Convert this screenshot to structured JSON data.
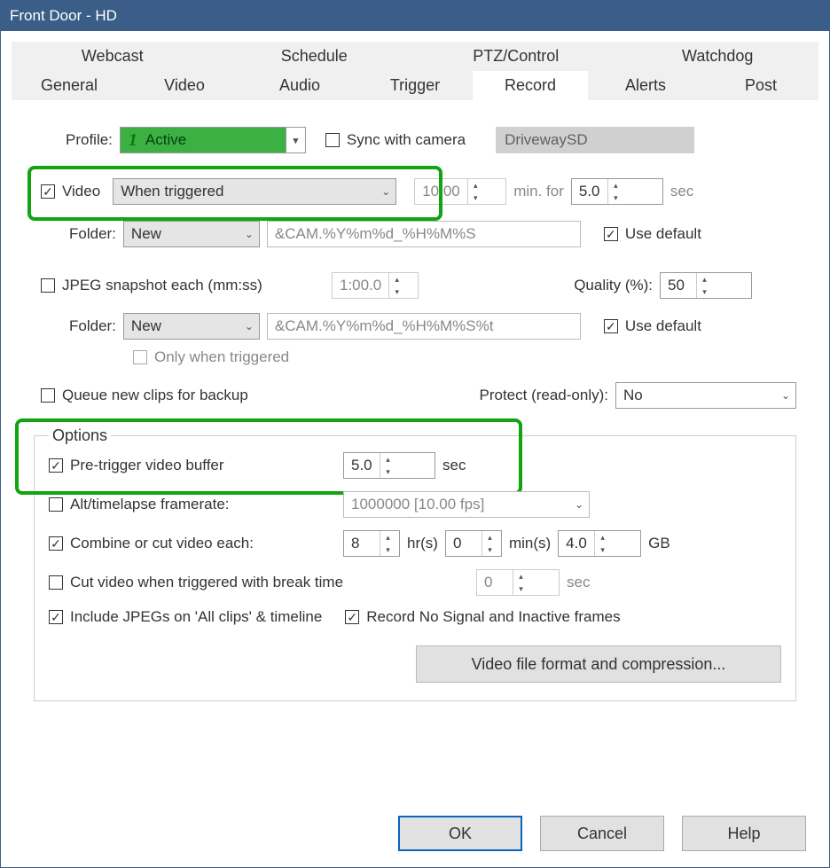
{
  "title": "Front Door - HD",
  "tabs_top": [
    "Webcast",
    "Schedule",
    "PTZ/Control",
    "Watchdog"
  ],
  "tabs_bottom": [
    "General",
    "Video",
    "Audio",
    "Trigger",
    "Record",
    "Alerts",
    "Post"
  ],
  "active_tab": "Record",
  "profile": {
    "label": "Profile:",
    "num": "1",
    "value": "Active",
    "sync_label": "Sync with camera",
    "sync_checked": false,
    "camera_value": "DrivewaySD"
  },
  "video": {
    "checked": true,
    "label": "Video",
    "mode": "When triggered",
    "time": "10:00",
    "min_for": "min. for",
    "duration": "5.0",
    "sec": "sec"
  },
  "folder1": {
    "label": "Folder:",
    "value": "New",
    "pattern": "&CAM.%Y%m%d_%H%M%S",
    "use_default_label": "Use default",
    "use_default_checked": true
  },
  "jpeg": {
    "checked": false,
    "label": "JPEG snapshot each (mm:ss)",
    "interval": "1:00.0",
    "quality_label": "Quality (%):",
    "quality_value": "50"
  },
  "folder2": {
    "label": "Folder:",
    "value": "New",
    "pattern": "&CAM.%Y%m%d_%H%M%S%t",
    "use_default_label": "Use default",
    "use_default_checked": true
  },
  "only_when_triggered": {
    "checked": false,
    "label": "Only when triggered"
  },
  "queue_backup": {
    "checked": false,
    "label": "Queue new clips for backup"
  },
  "protect": {
    "label": "Protect (read-only):",
    "value": "No"
  },
  "options": {
    "legend": "Options",
    "pretrigger": {
      "checked": true,
      "label": "Pre-trigger video buffer",
      "value": "5.0",
      "unit": "sec"
    },
    "alt_framerate": {
      "checked": false,
      "label": "Alt/timelapse framerate:",
      "value": "1000000 [10.00 fps]"
    },
    "combine": {
      "checked": true,
      "label": "Combine or cut video each:",
      "hrs": "8",
      "hrs_unit": "hr(s)",
      "mins": "0",
      "mins_unit": "min(s)",
      "gb": "4.0",
      "gb_unit": "GB"
    },
    "cut_break": {
      "checked": false,
      "label": "Cut video when triggered with break time",
      "value": "0",
      "unit": "sec"
    },
    "include_jpegs": {
      "checked": true,
      "label": "Include JPEGs on 'All clips' & timeline"
    },
    "record_nosignal": {
      "checked": true,
      "label": "Record No Signal and Inactive frames"
    },
    "format_button": "Video file format and compression..."
  },
  "footer": {
    "ok": "OK",
    "cancel": "Cancel",
    "help": "Help"
  }
}
